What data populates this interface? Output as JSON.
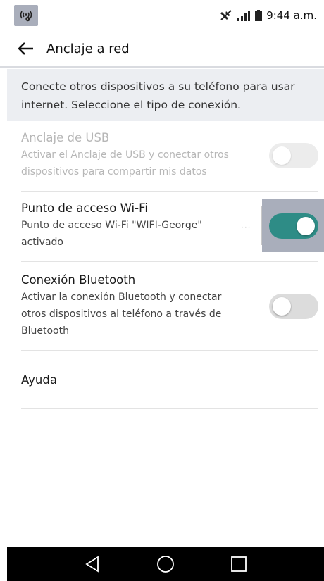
{
  "status_bar": {
    "time": "9:44 a.m.",
    "icons": [
      "hotspot-icon",
      "mute-icon",
      "signal-icon",
      "battery-icon"
    ]
  },
  "app_bar": {
    "title": "Anclaje a red",
    "back_icon": "arrow-left-icon"
  },
  "description": "Conecte otros dispositivos a su teléfono para usar internet. Seleccione el tipo de conexión.",
  "items": [
    {
      "title": "Anclaje de USB",
      "subtitle_lines": [
        "Activar el Anclaje de USB y conectar otros",
        "dispositivos para compartir mis datos"
      ],
      "toggle": "off",
      "enabled": false
    },
    {
      "title": "Punto de acceso Wi-Fi",
      "subtitle_lines": [
        "Punto de acceso Wi-Fi \"WIFI-George\"",
        "activado"
      ],
      "toggle": "on",
      "enabled": true
    },
    {
      "title": "Conexión Bluetooth",
      "subtitle_lines": [
        "Activar la conexión Bluetooth y conectar",
        "otros dispositivos al teléfono a través de",
        "Bluetooth"
      ],
      "toggle": "off",
      "enabled": true
    },
    {
      "title": "Ayuda"
    }
  ],
  "colors": {
    "toggle_on": "#2e8c86",
    "toggle_off": "#dcdcdc",
    "description_bg": "#eceef2",
    "highlight": "#a9aebb",
    "nav_bar": "#000000"
  },
  "nav_bar": {
    "icons": [
      "back-triangle-icon",
      "home-circle-icon",
      "recents-square-icon"
    ]
  }
}
